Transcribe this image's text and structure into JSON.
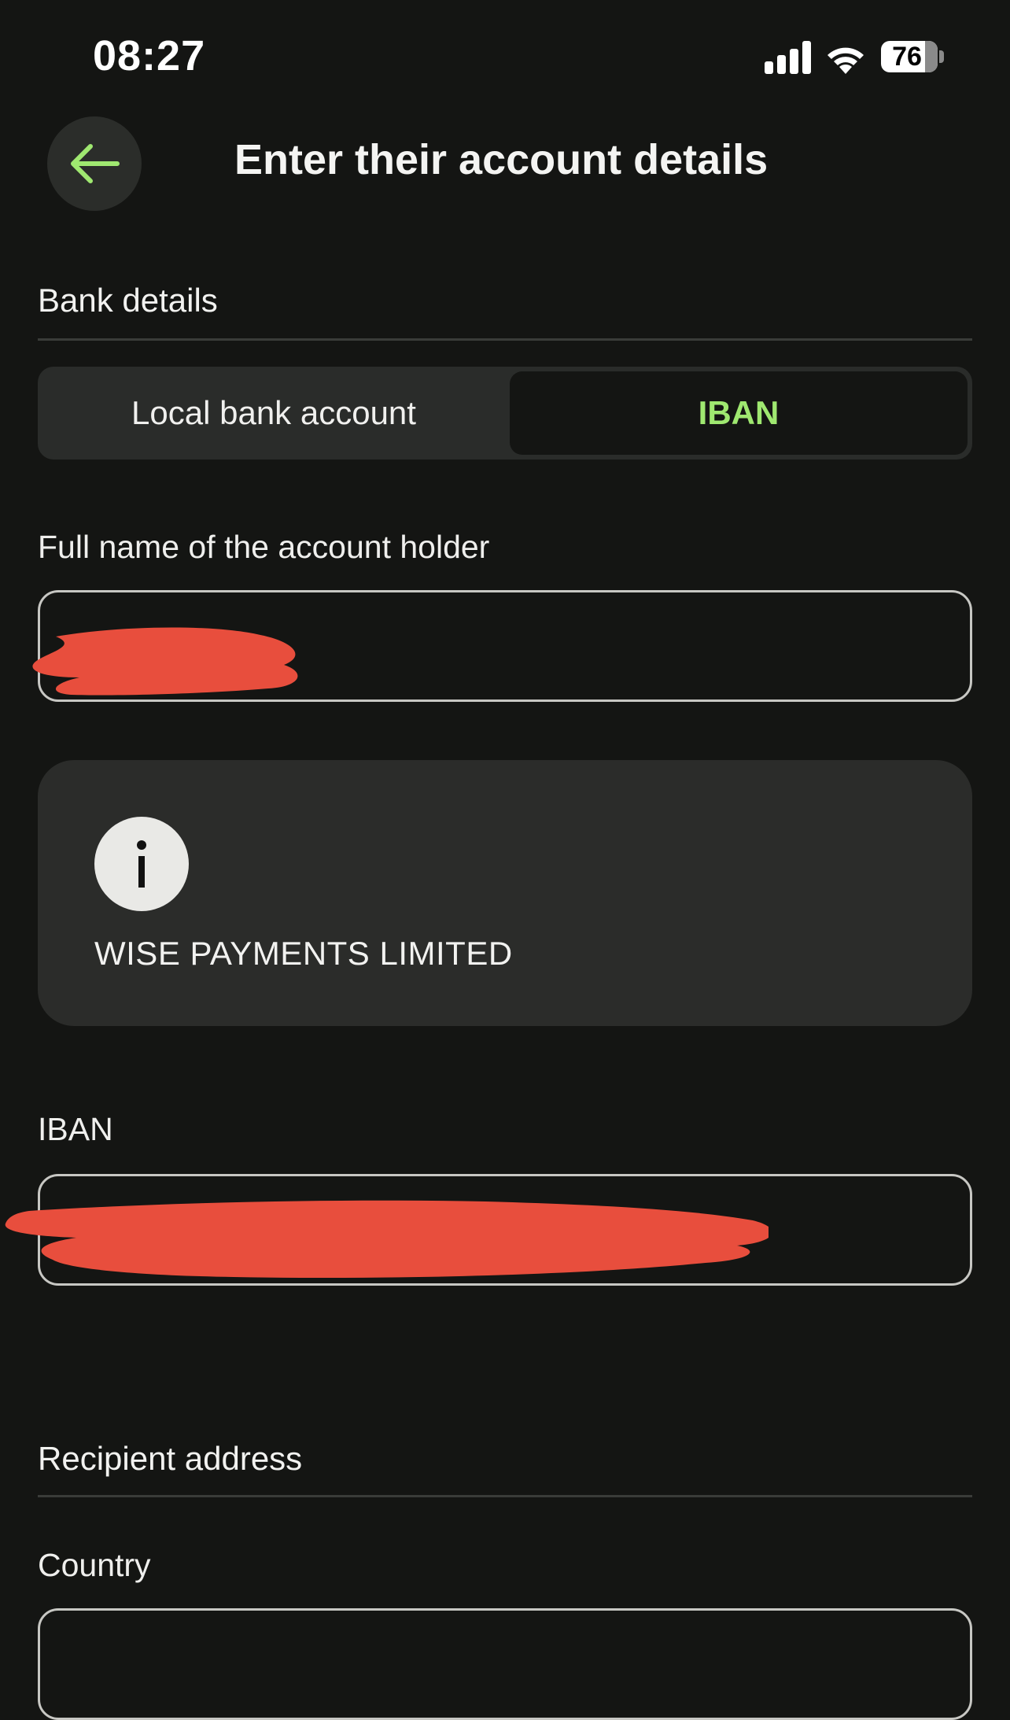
{
  "status_bar": {
    "time": "08:27",
    "battery": "76",
    "battery_level": 0.76,
    "icons": [
      "signal-icon",
      "wifi-icon",
      "battery-icon"
    ]
  },
  "header": {
    "back_icon": "arrow-left-icon",
    "title": "Enter their account details"
  },
  "bank_details": {
    "heading": "Bank details",
    "tabs": [
      {
        "label": "Local bank account",
        "selected": false
      },
      {
        "label": "IBAN",
        "selected": true
      }
    ],
    "full_name_label": "Full name of the account holder",
    "full_name_value": "",
    "info_icon": "info-icon",
    "info_text": "WISE PAYMENTS LIMITED",
    "iban_label": "IBAN",
    "iban_value": ""
  },
  "recipient_address": {
    "heading": "Recipient address",
    "country_label": "Country",
    "country_value": ""
  },
  "colors": {
    "background": "#141513",
    "accent_green": "#9fe870",
    "card": "#2b2c2a",
    "redaction": "#e84e3d"
  }
}
